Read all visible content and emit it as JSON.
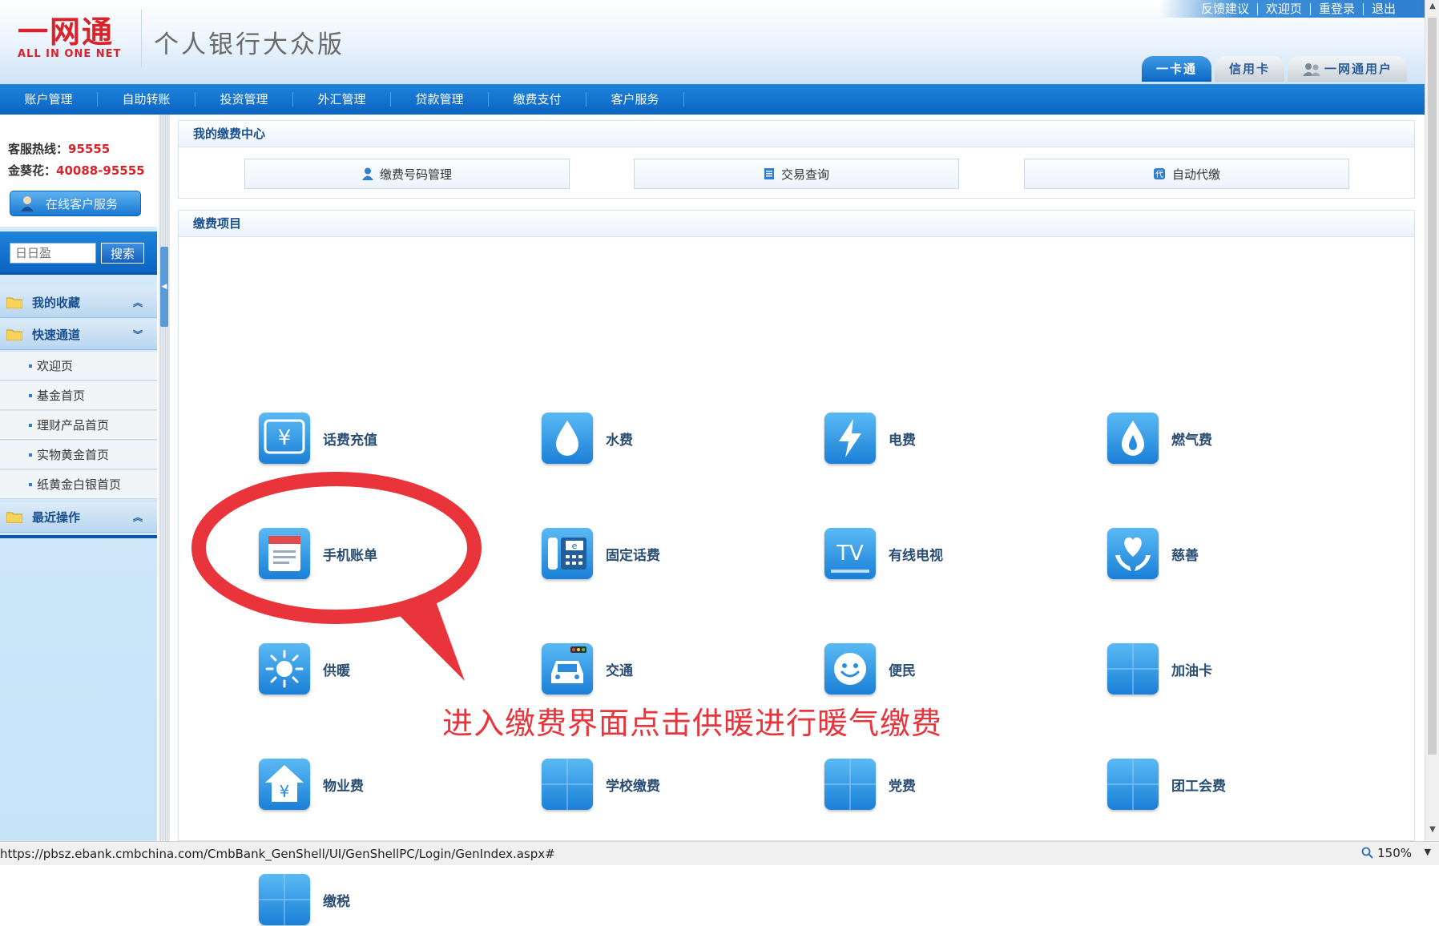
{
  "header": {
    "logo_main": "一网通",
    "logo_sub": "ALL IN ONE NET",
    "app_title": "个人银行大众版",
    "top_links": [
      "反馈建议",
      "欢迎页",
      "重登录",
      "退出"
    ],
    "user_tabs": [
      "一卡通",
      "信用卡",
      "一网通用户"
    ]
  },
  "nav": [
    "账户管理",
    "自助转账",
    "投资管理",
    "外汇管理",
    "贷款管理",
    "缴费支付",
    "客户服务"
  ],
  "sidebar": {
    "hotline_label": "客服热线：",
    "hotline_number": "95555",
    "gold_label": "金葵花：",
    "gold_number": "40088-95555",
    "online_service": "在线客户服务",
    "search_placeholder": "日日盈",
    "search_button": "搜索",
    "sections": {
      "favorites": "我的收藏",
      "quick": "快速通道",
      "recent": "最近操作"
    },
    "quick_items": [
      "欢迎页",
      "基金首页",
      "理财产品首页",
      "实物黄金首页",
      "纸黄金白银首页"
    ]
  },
  "main": {
    "center_title": "我的缴费中心",
    "quick_buttons": [
      "缴费号码管理",
      "交易查询",
      "自动代缴"
    ],
    "items_title": "缴费项目",
    "items": [
      "话费充值",
      "水费",
      "电费",
      "燃气费",
      "手机账单",
      "固定话费",
      "有线电视",
      "慈善",
      "供暖",
      "交通",
      "便民",
      "加油卡",
      "物业费",
      "学校缴费",
      "党费",
      "团工会费",
      "缴税"
    ]
  },
  "annotation": {
    "text": "进入缴费界面点击供暖进行暖气缴费",
    "color": "#e8343a"
  },
  "status": {
    "url": "https://pbsz.ebank.cmbchina.com/CmbBank_GenShell/UI/GenShellPC/Login/GenIndex.aspx#",
    "zoom": "150%"
  },
  "colors": {
    "brand_red": "#d8232a",
    "nav_blue": "#0b64c2",
    "tile_blue": "#1a7fd7"
  }
}
